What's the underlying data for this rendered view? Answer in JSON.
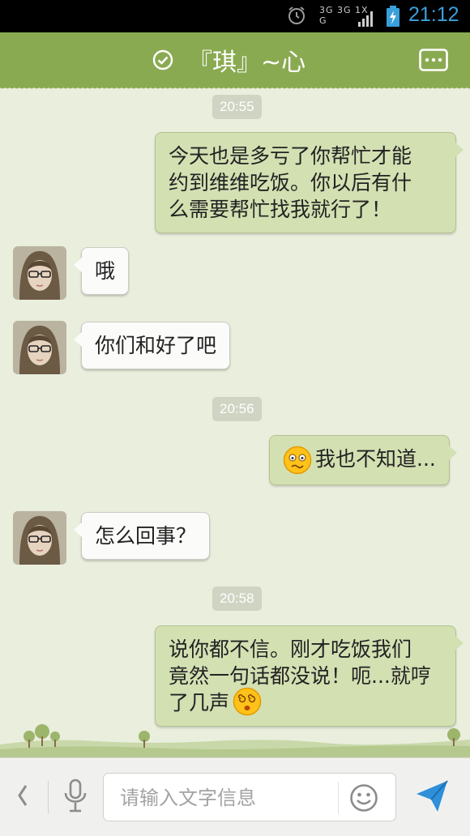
{
  "status_bar": {
    "network_labels": "3G 3G 1X G",
    "time": "21:12"
  },
  "header": {
    "title": "『琪』~心",
    "icons": [
      "online-check-icon",
      "more-menu-icon"
    ]
  },
  "messages": [
    {
      "kind": "time",
      "text": "20:55"
    },
    {
      "kind": "outgoing",
      "lines": [
        "今天也是多亏了你帮忙才能",
        "约到维维吃饭。你以后有什",
        "么需要帮忙找我就行了！"
      ]
    },
    {
      "kind": "incoming",
      "text": "哦"
    },
    {
      "kind": "incoming",
      "text": "你们和好了吧"
    },
    {
      "kind": "time",
      "text": "20:56"
    },
    {
      "kind": "outgoing",
      "emoji": "confused-face-icon",
      "text": "我也不知道..."
    },
    {
      "kind": "incoming",
      "text": "怎么回事？"
    },
    {
      "kind": "time",
      "text": "20:58"
    },
    {
      "kind": "outgoing",
      "lines": [
        "说你都不信。刚才吃饭我们",
        "竟然一句话都没说！呃...就哼",
        "了几声"
      ],
      "emoji": "dizzy-face-icon"
    }
  ],
  "input_bar": {
    "placeholder": "请输入文字信息",
    "value": ""
  },
  "colors": {
    "header": "#8aaa52",
    "outgoing_bubble": "#d3e0b2",
    "incoming_bubble": "#fbfbfa",
    "background": "#e9eedd",
    "clock": "#3aa0dc"
  }
}
